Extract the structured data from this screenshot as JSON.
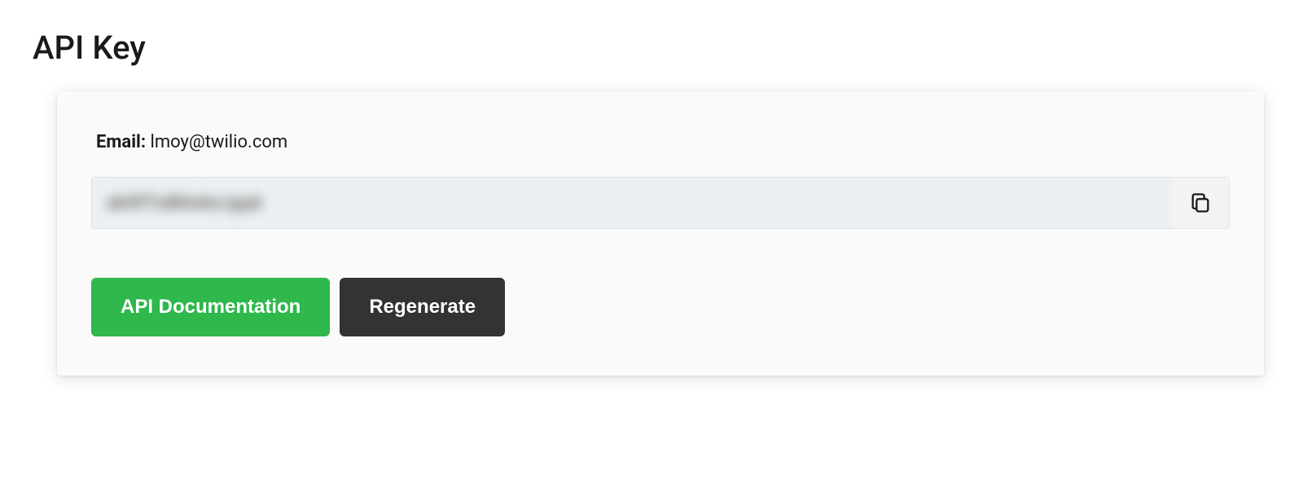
{
  "page": {
    "title": "API Key"
  },
  "card": {
    "email_label": "Email:",
    "email_value": "lmoy@twilio.com",
    "api_key_masked": "abXf7u8bIskz/gqA",
    "copy_icon_name": "copy-icon"
  },
  "buttons": {
    "docs": "API Documentation",
    "regenerate": "Regenerate"
  },
  "colors": {
    "primary_btn": "#2fb84c",
    "secondary_btn": "#333333",
    "card_bg": "#fafafa",
    "key_field_bg": "#edf0f2"
  }
}
